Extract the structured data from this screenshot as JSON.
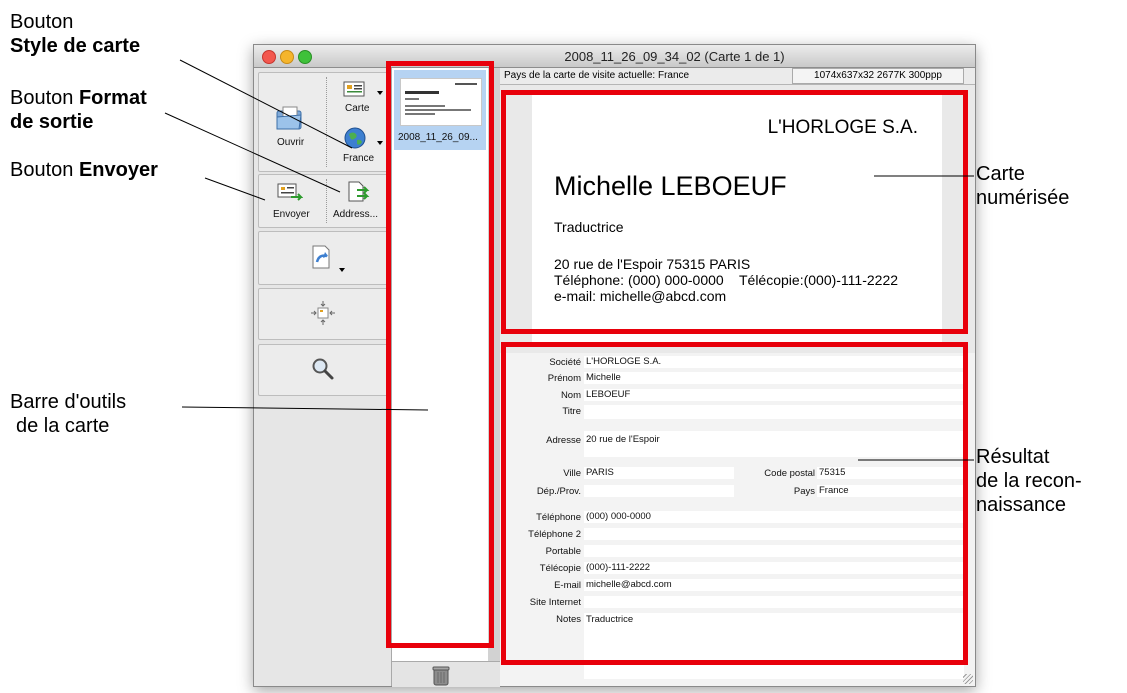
{
  "window": {
    "title": "2008_11_26_09_34_02 (Carte 1 de 1)",
    "traffic_colors": [
      "#f3584f",
      "#f5b52c",
      "#3fc13a"
    ]
  },
  "toolbar": {
    "open_label": "Ouvrir",
    "card_style_label": "Carte",
    "output_format_label": "France",
    "send_label": "Envoyer",
    "address_label": "Address..."
  },
  "thumbnails": {
    "items": [
      {
        "label": "2008_11_26_09..."
      }
    ]
  },
  "info_bar": {
    "country_text": "Pays de la carte de visite actuelle: France",
    "image_info": "1074x637x32  2677K  300ppp"
  },
  "card": {
    "company": "L'HORLOGE S.A.",
    "name": "Michelle LEBOEUF",
    "job": "Traductrice",
    "address": "20 rue de l'Espoir 75315 PARIS",
    "phone_fax": "Téléphone: (000) 000-0000    Télécopie:(000)-111-2222",
    "email": "e-mail: michelle@abcd.com"
  },
  "form": {
    "societe": {
      "label": "Société",
      "value": "L'HORLOGE S.A."
    },
    "prenom": {
      "label": "Prénom",
      "value": "Michelle"
    },
    "nom": {
      "label": "Nom",
      "value": "LEBOEUF"
    },
    "titre": {
      "label": "Titre",
      "value": ""
    },
    "adresse": {
      "label": "Adresse",
      "value": "20 rue de l'Espoir"
    },
    "ville": {
      "label": "Ville",
      "value": "PARIS"
    },
    "code_postal": {
      "label": "Code postal",
      "value": "75315"
    },
    "dep": {
      "label": "Dép./Prov.",
      "value": ""
    },
    "pays": {
      "label": "Pays",
      "value": "France"
    },
    "telephone": {
      "label": "Téléphone",
      "value": "(000) 000-0000"
    },
    "telephone2": {
      "label": "Téléphone 2",
      "value": ""
    },
    "portable": {
      "label": "Portable",
      "value": ""
    },
    "telecopie": {
      "label": "Télécopie",
      "value": "(000)-111-2222"
    },
    "email": {
      "label": "E-mail",
      "value": "michelle@abcd.com"
    },
    "site": {
      "label": "Site Internet",
      "value": ""
    },
    "notes": {
      "label": "Notes",
      "value": "Traductrice"
    }
  },
  "callouts": {
    "card_style_1": "Bouton",
    "card_style_2": "Style de carte",
    "output_format_1": "Bouton",
    "output_format_2": "Format",
    "output_format_3": "de sortie",
    "send_1": "Bouton",
    "send_2": "Envoyer",
    "toolbar_1": "Barre d'outils",
    "toolbar_2": "de la carte",
    "scanned_1": "Carte",
    "scanned_2": "numérisée",
    "result_1": "Résultat",
    "result_2": "de la recon-",
    "result_3": "naissance"
  },
  "colors": {
    "highlight": "#e8000b",
    "selection": "#b6d3f2"
  }
}
